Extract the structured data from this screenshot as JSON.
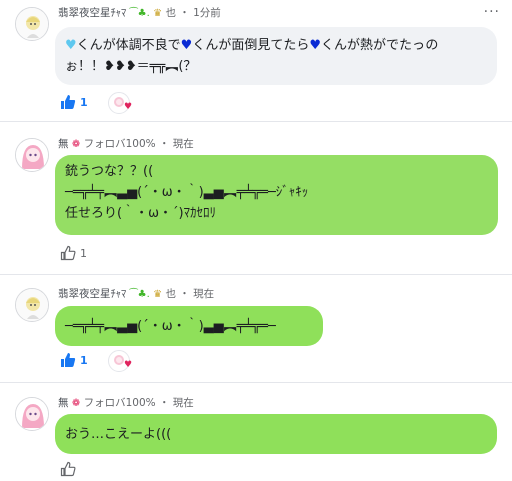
{
  "posts": [
    {
      "author": "翡翠夜空星ﾁｬﾏ",
      "author_suffix": "也",
      "time": "1分前",
      "lines": [
        [
          "♥",
          "くんが体調不良で",
          "♥",
          "くんが面倒見てたら",
          "♥",
          "くんが熱がでたっの"
        ],
        [
          "ぉ！！❥❥❥＝╤╦︻(？"
        ]
      ],
      "likes": "1"
    },
    {
      "author": "無",
      "author_suffix": "フォロバ100%",
      "time": "現在",
      "lines": [
        "銃うつな？？((",
        "─═╦╧╤︻▃▅(´・ω・｀)▃▅︻╤╧╦═─ｼﾞｬｷｯ",
        "任せろり(｀・ω・´)ﾏｶｾﾛﾘ"
      ],
      "likes": "1"
    },
    {
      "author": "翡翠夜空星ﾁｬﾏ",
      "author_suffix": "也",
      "time": "現在",
      "lines": [
        "─═╦╧╤︻▃▅(´・ω・｀)▃▅︻╤╧╦═─"
      ],
      "likes": "1"
    },
    {
      "author": "無",
      "author_suffix": "フォロバ100%",
      "time": "現在",
      "lines": [
        "おう…こえーよ((("
      ]
    }
  ],
  "colors": {
    "like_blue": "#1877f2",
    "bubble_gray": "#f0f2f5",
    "bubble_green": "#95de64"
  },
  "icons": [
    "like-thumb-icon",
    "more-options-icon",
    "heart-reaction-icon"
  ]
}
